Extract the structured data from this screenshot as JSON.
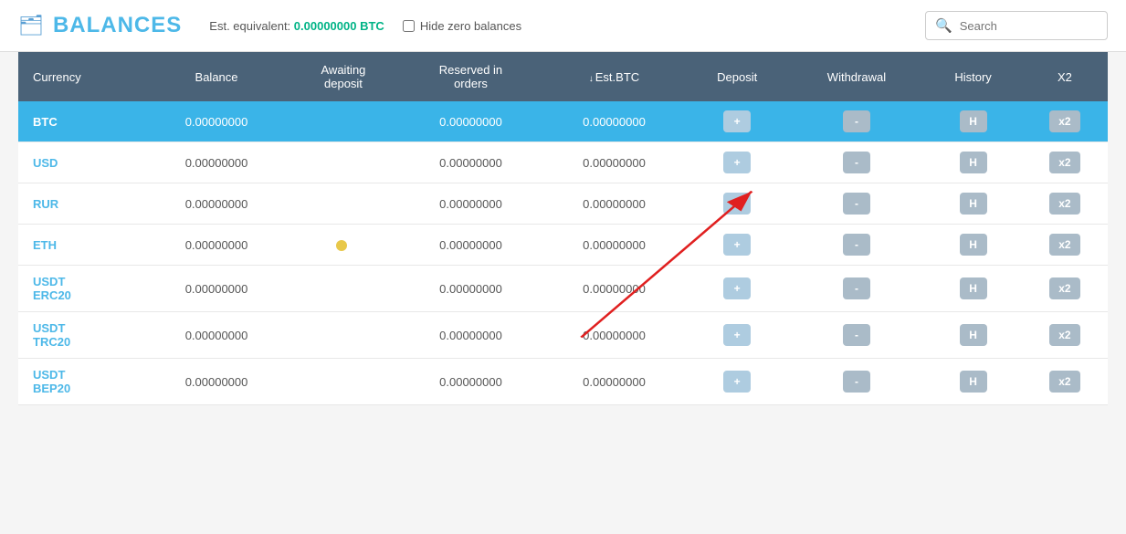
{
  "header": {
    "icon": "🗂",
    "title": "BALANCES",
    "est_label": "Est. equivalent:",
    "est_value": "0.00000000 BTC",
    "hide_zero_label": "Hide zero balances",
    "search_placeholder": "Search"
  },
  "table": {
    "columns": [
      {
        "key": "currency",
        "label": "Currency"
      },
      {
        "key": "balance",
        "label": "Balance"
      },
      {
        "key": "awaiting",
        "label": "Awaiting deposit"
      },
      {
        "key": "reserved",
        "label": "Reserved in orders"
      },
      {
        "key": "estbtc",
        "label": "Est.BTC",
        "sorted": true
      },
      {
        "key": "deposit",
        "label": "Deposit"
      },
      {
        "key": "withdrawal",
        "label": "Withdrawal"
      },
      {
        "key": "history",
        "label": "History"
      },
      {
        "key": "x2",
        "label": "X2"
      }
    ],
    "rows": [
      {
        "currency": "BTC",
        "balance": "0.00000000",
        "awaiting": "",
        "reserved": "0.00000000",
        "estbtc": "0.00000000",
        "highlighted": true
      },
      {
        "currency": "USD",
        "balance": "0.00000000",
        "awaiting": "",
        "reserved": "0.00000000",
        "estbtc": "0.00000000"
      },
      {
        "currency": "RUR",
        "balance": "0.00000000",
        "awaiting": "",
        "reserved": "0.00000000",
        "estbtc": "0.00000000"
      },
      {
        "currency": "ETH",
        "balance": "0.00000000",
        "awaiting": "",
        "reserved": "0.00000000",
        "estbtc": "0.00000000",
        "has_dot": true
      },
      {
        "currency": "USDT\nERC20",
        "balance": "0.00000000",
        "awaiting": "",
        "reserved": "0.00000000",
        "estbtc": "0.00000000"
      },
      {
        "currency": "USDT\nTRC20",
        "balance": "0.00000000",
        "awaiting": "",
        "reserved": "0.00000000",
        "estbtc": "0.00000000"
      },
      {
        "currency": "USDT\nBEP20",
        "balance": "0.00000000",
        "awaiting": "",
        "reserved": "0.00000000",
        "estbtc": "0.00000000"
      }
    ],
    "buttons": {
      "deposit": "+",
      "withdrawal": "-",
      "history": "H",
      "x2": "x2"
    }
  }
}
